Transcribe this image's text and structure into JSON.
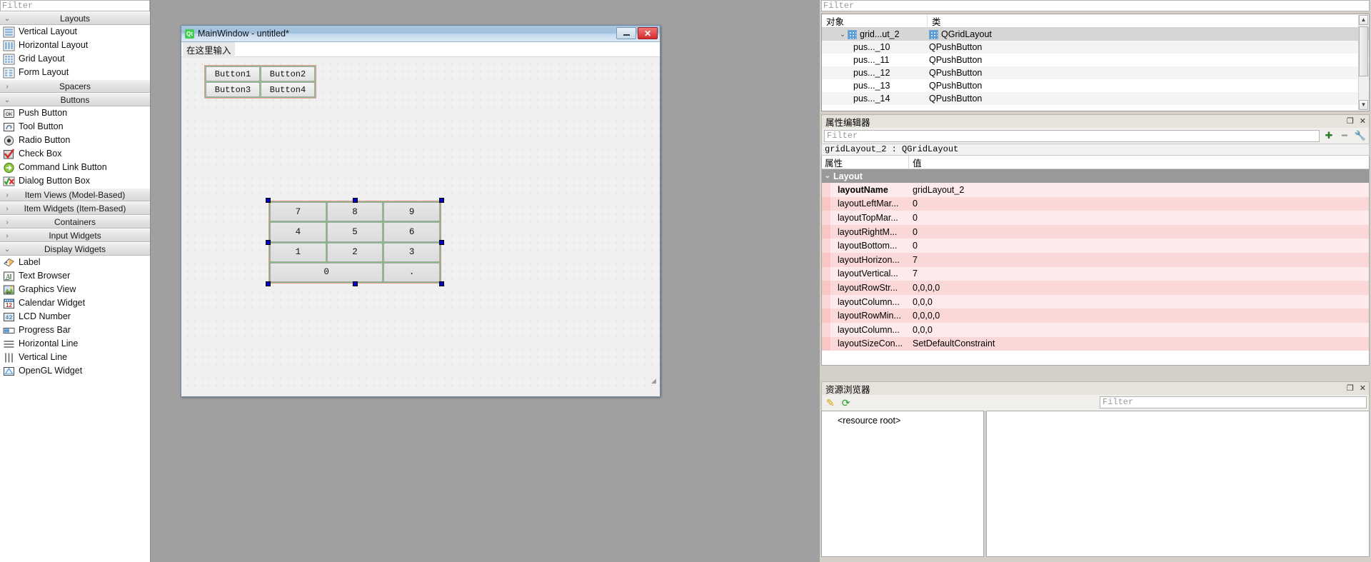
{
  "widget_box": {
    "filter_placeholder": "Filter",
    "groups": [
      {
        "label": "Layouts",
        "expanded": true,
        "arrow": "⌄",
        "items": [
          {
            "label": "Vertical Layout",
            "icon": "vertical-layout-icon"
          },
          {
            "label": "Horizontal Layout",
            "icon": "horizontal-layout-icon"
          },
          {
            "label": "Grid Layout",
            "icon": "grid-layout-icon"
          },
          {
            "label": "Form Layout",
            "icon": "form-layout-icon"
          }
        ]
      },
      {
        "label": "Spacers",
        "expanded": false,
        "arrow": "›",
        "items": []
      },
      {
        "label": "Buttons",
        "expanded": true,
        "arrow": "⌄",
        "items": [
          {
            "label": "Push Button",
            "icon": "push-button-icon"
          },
          {
            "label": "Tool Button",
            "icon": "tool-button-icon"
          },
          {
            "label": "Radio Button",
            "icon": "radio-button-icon"
          },
          {
            "label": "Check Box",
            "icon": "check-box-icon"
          },
          {
            "label": "Command Link Button",
            "icon": "command-link-button-icon"
          },
          {
            "label": "Dialog Button Box",
            "icon": "dialog-button-box-icon"
          }
        ]
      },
      {
        "label": "Item Views (Model-Based)",
        "expanded": false,
        "arrow": "›",
        "items": []
      },
      {
        "label": "Item Widgets (Item-Based)",
        "expanded": false,
        "arrow": "›",
        "items": []
      },
      {
        "label": "Containers",
        "expanded": false,
        "arrow": "›",
        "items": []
      },
      {
        "label": "Input Widgets",
        "expanded": false,
        "arrow": "›",
        "items": []
      },
      {
        "label": "Display Widgets",
        "expanded": true,
        "arrow": "⌄",
        "items": [
          {
            "label": "Label",
            "icon": "label-icon"
          },
          {
            "label": "Text Browser",
            "icon": "text-browser-icon"
          },
          {
            "label": "Graphics View",
            "icon": "graphics-view-icon"
          },
          {
            "label": "Calendar Widget",
            "icon": "calendar-widget-icon"
          },
          {
            "label": "LCD Number",
            "icon": "lcd-number-icon"
          },
          {
            "label": "Progress Bar",
            "icon": "progress-bar-icon"
          },
          {
            "label": "Horizontal Line",
            "icon": "horizontal-line-icon"
          },
          {
            "label": "Vertical Line",
            "icon": "vertical-line-icon"
          },
          {
            "label": "OpenGL Widget",
            "icon": "opengl-widget-icon"
          }
        ]
      }
    ]
  },
  "form": {
    "title": "MainWindow - untitled*",
    "logo_text": "Qt",
    "minimize_label": "–",
    "close_label": "✕",
    "menu_placeholder": "在这里输入",
    "top_buttons": [
      "Button1",
      "Button2",
      "Button3",
      "Button4"
    ],
    "calc_buttons": [
      "7",
      "8",
      "9",
      "4",
      "5",
      "6",
      "1",
      "2",
      "3",
      "0",
      "."
    ],
    "size_grip": "◢"
  },
  "object_inspector": {
    "filter_placeholder": "Filter",
    "columns": [
      "对象",
      "类"
    ],
    "rows": [
      {
        "name": "grid...ut_2",
        "class": "QGridLayout",
        "indent": 1,
        "expander": "⌄",
        "selected": true,
        "icon": "grid-layout-icon"
      },
      {
        "name": "pus..._10",
        "class": "QPushButton",
        "indent": 2,
        "expander": "",
        "selected": false,
        "icon": ""
      },
      {
        "name": "pus..._11",
        "class": "QPushButton",
        "indent": 2,
        "expander": "",
        "selected": false,
        "icon": ""
      },
      {
        "name": "pus..._12",
        "class": "QPushButton",
        "indent": 2,
        "expander": "",
        "selected": false,
        "icon": ""
      },
      {
        "name": "pus..._13",
        "class": "QPushButton",
        "indent": 2,
        "expander": "",
        "selected": false,
        "icon": ""
      },
      {
        "name": "pus..._14",
        "class": "QPushButton",
        "indent": 2,
        "expander": "",
        "selected": false,
        "icon": ""
      }
    ]
  },
  "property_editor": {
    "dock_title": "属性编辑器",
    "float_btn": "❐",
    "close_btn": "✕",
    "filter_placeholder": "Filter",
    "add_btn": "➕",
    "remove_btn": "➖",
    "config_btn": "🔧",
    "object_line": "gridLayout_2 : QGridLayout",
    "columns": [
      "属性",
      "值"
    ],
    "group": {
      "label": "Layout",
      "arrow": "⌄"
    },
    "rows": [
      {
        "key": "layoutName",
        "value": "gridLayout_2",
        "bold": true
      },
      {
        "key": "layoutLeftMar...",
        "value": "0",
        "bold": false
      },
      {
        "key": "layoutTopMar...",
        "value": "0",
        "bold": false
      },
      {
        "key": "layoutRightM...",
        "value": "0",
        "bold": false
      },
      {
        "key": "layoutBottom...",
        "value": "0",
        "bold": false
      },
      {
        "key": "layoutHorizon...",
        "value": "7",
        "bold": false
      },
      {
        "key": "layoutVertical...",
        "value": "7",
        "bold": false
      },
      {
        "key": "layoutRowStr...",
        "value": "0,0,0,0",
        "bold": false
      },
      {
        "key": "layoutColumn...",
        "value": "0,0,0",
        "bold": false
      },
      {
        "key": "layoutRowMin...",
        "value": "0,0,0,0",
        "bold": false
      },
      {
        "key": "layoutColumn...",
        "value": "0,0,0",
        "bold": false
      },
      {
        "key": "layoutSizeCon...",
        "value": "SetDefaultConstraint",
        "bold": false
      }
    ]
  },
  "resource_browser": {
    "dock_title": "资源浏览器",
    "float_btn": "❐",
    "close_btn": "✕",
    "edit_icon": "✎",
    "reload_icon": "⟳",
    "filter_placeholder": "Filter",
    "tree_root": "<resource root>"
  }
}
